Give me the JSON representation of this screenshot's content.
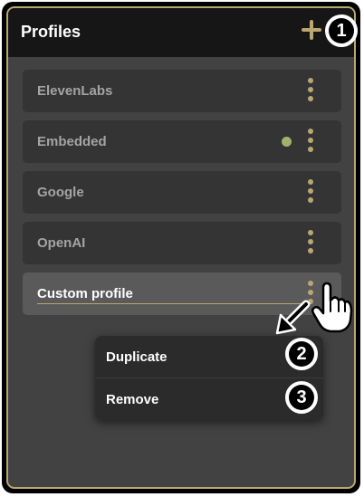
{
  "header": {
    "title": "Profiles",
    "add_icon": "plus-icon"
  },
  "profiles": [
    {
      "label": "ElevenLabs",
      "active": false,
      "selected": false
    },
    {
      "label": "Embedded",
      "active": true,
      "selected": false
    },
    {
      "label": "Google",
      "active": false,
      "selected": false
    },
    {
      "label": "OpenAI",
      "active": false,
      "selected": false
    },
    {
      "label": "Custom profile",
      "active": false,
      "selected": true
    }
  ],
  "context_menu": {
    "items": [
      {
        "label": "Duplicate"
      },
      {
        "label": "Remove"
      }
    ]
  },
  "callouts": {
    "add": "1",
    "duplicate": "2",
    "remove": "3"
  },
  "colors": {
    "accent": "#b9a772",
    "active_dot": "#a3b26a",
    "panel_bg": "#424242",
    "header_bg": "#161616"
  },
  "icons": [
    "plus-icon",
    "kebab-menu-icon",
    "status-dot",
    "arrow-icon",
    "pointer-hand-icon"
  ]
}
